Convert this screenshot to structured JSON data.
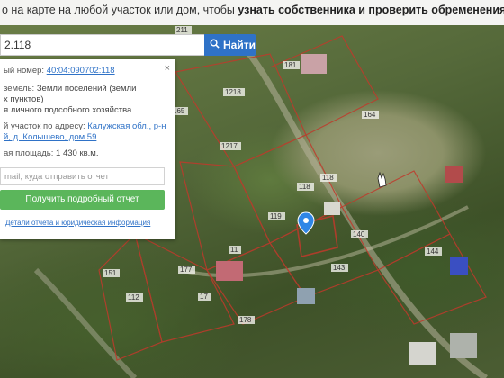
{
  "top_note": {
    "text_plain": "о на карте на любой участок или дом, чтобы ",
    "text_bold": "узнать собственника и проверить обременения",
    "text_end": "."
  },
  "search": {
    "value": "2.118",
    "button_label": "Найти",
    "button_icon": "search-icon"
  },
  "panel": {
    "close_glyph": "×",
    "cadastral_label": "ый номер:",
    "cadastral_value": "40:04:090702:118",
    "land_category_label": "земель:",
    "land_category_value": "Земли поселений (земли",
    "land_category_value_2": "х пунктов)",
    "permitted_use": "я личного подсобного хозяйства",
    "address_label": "й участок по адресу:",
    "address_line1": "Калужская обл., р-н",
    "address_line2": "й, д. Колышево, дом 59",
    "area_label": "ая площадь:",
    "area_value": "1 430 кв.м.",
    "email_placeholder": "mail, куда отправить отчет",
    "report_button": "Получить подробный отчет",
    "details_link": "Детали отчета и юридическая информация"
  },
  "map": {
    "plot_labels": [
      "211",
      "181",
      "1218",
      "164",
      "165",
      "1217",
      "118",
      "119",
      "118",
      "140",
      "143",
      "11",
      "177",
      "112",
      "178",
      "17",
      "144",
      "151"
    ],
    "marker_icon": "location-pin-icon",
    "cursor_icon": "hand-cursor-icon"
  },
  "colors": {
    "accent_blue": "#2f72c7",
    "report_green": "#5bb65b",
    "boundary_red": "#c0392b"
  }
}
